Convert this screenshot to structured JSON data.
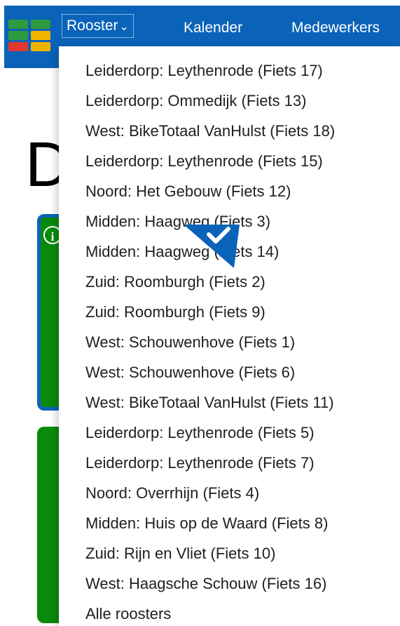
{
  "nav": {
    "items": [
      {
        "label": "Rooster",
        "has_dropdown": true
      },
      {
        "label": "Kalender"
      },
      {
        "label": "Medewerkers"
      }
    ]
  },
  "page": {
    "title_fragment": "D"
  },
  "dropdown": {
    "items": [
      "Leiderdorp: Leythenrode (Fiets 17)",
      "Leiderdorp: Ommedijk (Fiets 13)",
      "West: BikeTotaal VanHulst (Fiets 18)",
      "Leiderdorp: Leythenrode (Fiets 15)",
      "Noord: Het Gebouw (Fiets 12)",
      "Midden: Haagweg (Fiets 3)",
      "Midden: Haagweg (Fiets 14)",
      "Zuid: Roomburgh (Fiets 2)",
      "Zuid: Roomburgh (Fiets 9)",
      "West: Schouwenhove (Fiets 1)",
      "West: Schouwenhove (Fiets 6)",
      "West: BikeTotaal VanHulst (Fiets 11)",
      "Leiderdorp: Leythenrode (Fiets 5)",
      "Leiderdorp: Leythenrode (Fiets 7)",
      "Noord: Overrhijn (Fiets 4)",
      "Midden: Huis op de Waard (Fiets 8)",
      "Zuid: Rijn en Vliet (Fiets 10)",
      "West: Haagsche Schouw (Fiets 16)",
      "Alle roosters"
    ]
  },
  "icons": {
    "logo": "grid-logo-icon",
    "chevron": "chevron-down-icon",
    "info": "info-icon",
    "check": "checkmark-icon"
  },
  "colors": {
    "header_bg": "#0a63b8",
    "card_green": "#0a8a0a",
    "text": "#1f1f1f"
  }
}
